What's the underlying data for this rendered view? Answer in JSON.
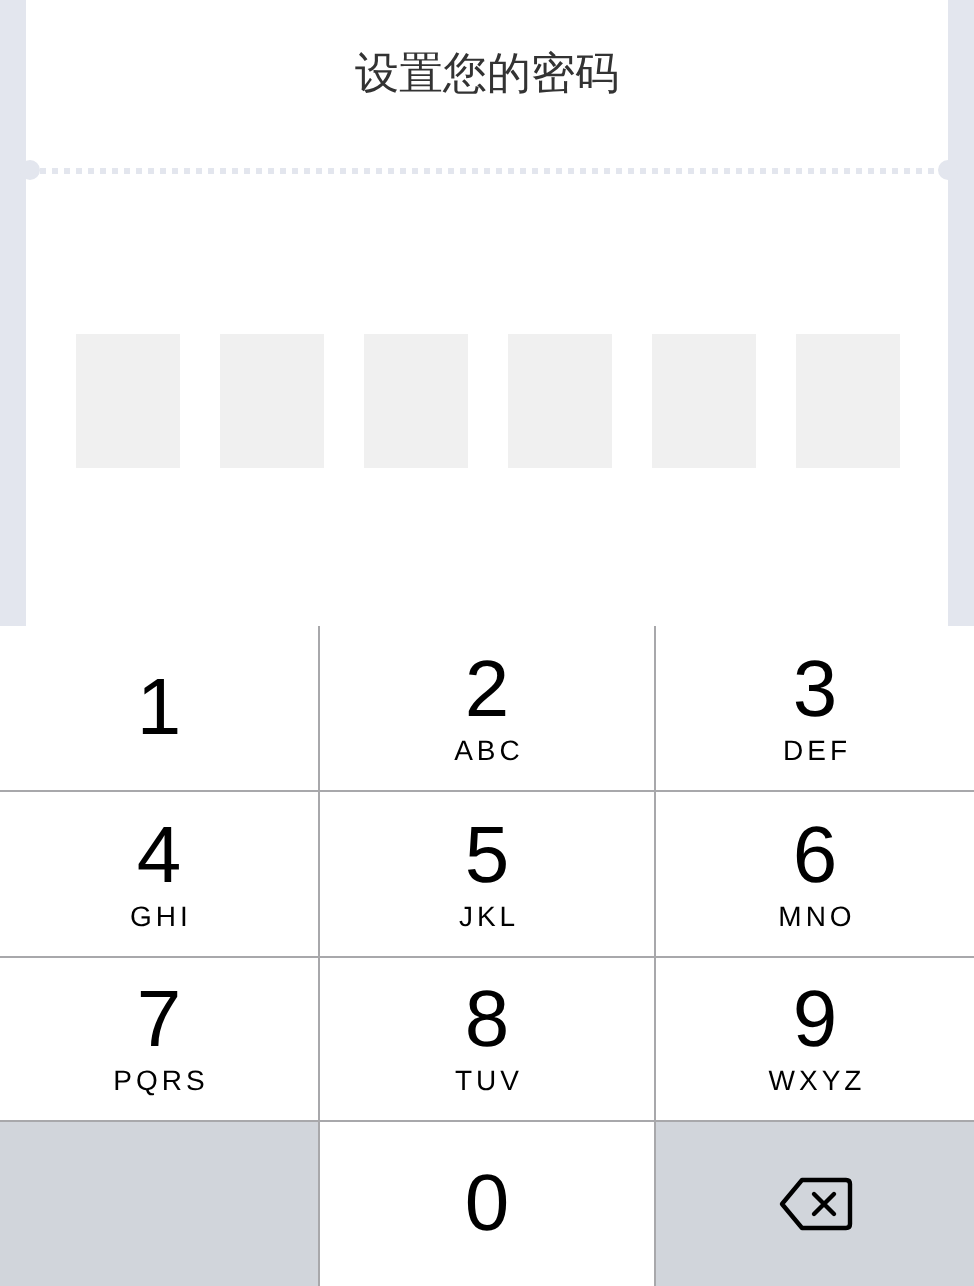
{
  "title": "设置您的密码",
  "pin_boxes": [
    {
      "filled": false
    },
    {
      "filled": false
    },
    {
      "filled": false
    },
    {
      "filled": false
    },
    {
      "filled": false
    },
    {
      "filled": false
    }
  ],
  "keypad": [
    {
      "kind": "digit",
      "digit": "1"
    },
    {
      "kind": "digit",
      "digit": "2",
      "letters": "ABC"
    },
    {
      "kind": "digit",
      "digit": "3",
      "letters": "DEF"
    },
    {
      "kind": "digit",
      "digit": "4",
      "letters": "GHI"
    },
    {
      "kind": "digit",
      "digit": "5",
      "letters": "JKL"
    },
    {
      "kind": "digit",
      "digit": "6",
      "letters": "MNO"
    },
    {
      "kind": "digit",
      "digit": "7",
      "letters": "PQRS"
    },
    {
      "kind": "digit",
      "digit": "8",
      "letters": "TUV"
    },
    {
      "kind": "digit",
      "digit": "9",
      "letters": "WXYZ"
    },
    {
      "kind": "blank"
    },
    {
      "kind": "digit",
      "digit": "0"
    },
    {
      "kind": "delete"
    }
  ]
}
